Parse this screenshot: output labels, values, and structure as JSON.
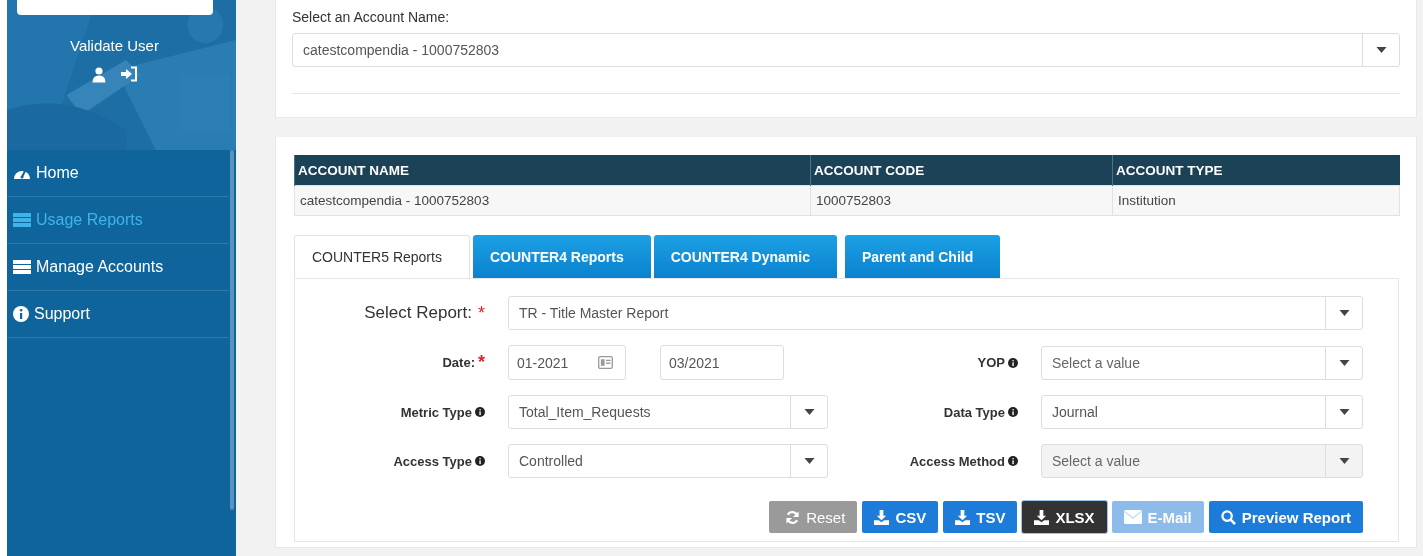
{
  "sidebar": {
    "title": "Validate User",
    "items": [
      {
        "label": "Home",
        "kind": "dashboard",
        "selected": false
      },
      {
        "label": "Usage Reports",
        "kind": "list",
        "selected": true
      },
      {
        "label": "Manage Accounts",
        "kind": "list",
        "selected": false
      },
      {
        "label": "Support",
        "kind": "info",
        "selected": false
      }
    ]
  },
  "account_select": {
    "label": "Select an Account Name:",
    "value": "catestcompendia - 1000752803"
  },
  "account_table": {
    "columns": [
      "ACCOUNT NAME",
      "ACCOUNT CODE",
      "ACCOUNT TYPE"
    ],
    "rows": [
      [
        "catestcompendia - 1000752803",
        "1000752803",
        "Institution"
      ]
    ]
  },
  "tabs": [
    {
      "label": "COUNTER5 Reports",
      "selected": true
    },
    {
      "label": "COUNTER4 Reports",
      "selected": false
    },
    {
      "label": "COUNTER4 Dynamic",
      "selected": false
    },
    {
      "label": "Parent and Child",
      "selected": false
    }
  ],
  "form": {
    "report": {
      "label": "Select Report:",
      "required_mark": "*",
      "value": "TR - Title Master Report"
    },
    "date": {
      "label": "Date:",
      "required_mark": "*",
      "from": "01-2021",
      "to": "03/2021"
    },
    "fields": [
      {
        "label": "YOP",
        "placeholder": "Select a value",
        "disabled": false
      },
      {
        "label": "Metric Type",
        "value": "Total_Item_Requests",
        "disabled": false
      },
      {
        "label": "Data Type",
        "value": "Journal",
        "disabled": false
      },
      {
        "label": "Access Type",
        "value": "Controlled",
        "disabled": false
      },
      {
        "label": "Access Method",
        "placeholder": "Select a value",
        "disabled": true
      }
    ]
  },
  "buttons": [
    {
      "label": "Reset",
      "kind": "reset",
      "active": false,
      "disabled": false
    },
    {
      "label": "CSV",
      "kind": "download",
      "active": false,
      "disabled": false
    },
    {
      "label": "TSV",
      "kind": "download",
      "active": false,
      "disabled": false
    },
    {
      "label": "XLSX",
      "kind": "download",
      "active": true,
      "disabled": false
    },
    {
      "label": "E-Mail",
      "kind": "email",
      "active": false,
      "disabled": true
    },
    {
      "label": "Preview Report",
      "kind": "preview",
      "active": false,
      "disabled": false
    }
  ]
}
